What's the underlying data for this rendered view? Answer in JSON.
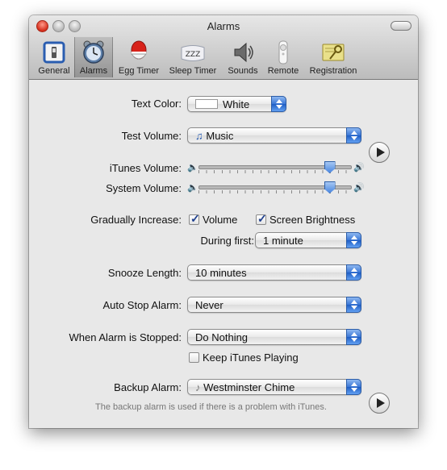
{
  "window": {
    "title": "Alarms"
  },
  "toolbar": {
    "items": [
      {
        "label": "General",
        "icon": "switch-icon"
      },
      {
        "label": "Alarms",
        "icon": "alarm-clock-icon",
        "selected": true
      },
      {
        "label": "Egg Timer",
        "icon": "egg-timer-icon"
      },
      {
        "label": "Sleep Timer",
        "icon": "sleep-pillow-icon",
        "badge": "ZZZ"
      },
      {
        "label": "Sounds",
        "icon": "speaker-icon"
      },
      {
        "label": "Remote",
        "icon": "remote-icon"
      },
      {
        "label": "Registration",
        "icon": "key-certificate-icon"
      }
    ]
  },
  "form": {
    "text_color": {
      "label": "Text Color:",
      "value": "White"
    },
    "test_volume": {
      "label": "Test Volume:",
      "value": "Music"
    },
    "itunes_volume": {
      "label": "iTunes Volume:",
      "level": 0.85
    },
    "system_volume": {
      "label": "System Volume:",
      "level": 0.85
    },
    "gradually_increase": {
      "label": "Gradually Increase:",
      "volume": {
        "label": "Volume",
        "checked": true
      },
      "brightness": {
        "label": "Screen Brightness",
        "checked": true
      }
    },
    "during_first": {
      "label": "During first:",
      "value": "1 minute"
    },
    "snooze_length": {
      "label": "Snooze Length:",
      "value": "10 minutes"
    },
    "auto_stop": {
      "label": "Auto Stop Alarm:",
      "value": "Never"
    },
    "when_stopped": {
      "label": "When Alarm is Stopped:",
      "value": "Do Nothing"
    },
    "keep_itunes": {
      "label": "Keep iTunes Playing",
      "checked": false
    },
    "backup_alarm": {
      "label": "Backup Alarm:",
      "value": "Westminster Chime"
    },
    "backup_hint": "The backup alarm is used if there is a problem with iTunes."
  },
  "colors": {
    "accent": "#3a76d6"
  }
}
